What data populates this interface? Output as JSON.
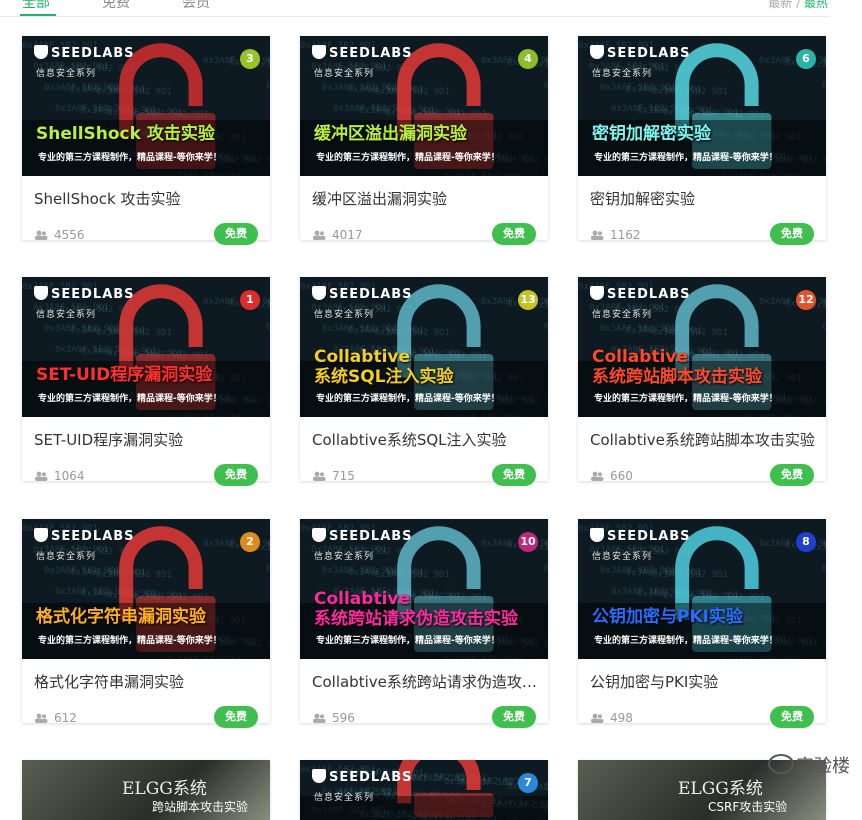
{
  "tabs": [
    {
      "label": "全部",
      "active": true
    },
    {
      "label": "免费",
      "active": false
    },
    {
      "label": "会员",
      "active": false
    }
  ],
  "sort": {
    "newest": "最新",
    "separator": "/",
    "hottest": "最热"
  },
  "logo": {
    "brand": "SEEDLABS",
    "series": "信息安全系列"
  },
  "tagline": "专业的第三方课程制作，精品课程-等你来学！",
  "courses": [
    {
      "banner_line1": "ShellShock 攻击实验",
      "banner_line2": "",
      "banner_color": "#b8f040",
      "number": "3",
      "num_color": "#9ac229",
      "lock_color": "#d32f2f",
      "title": "ShellShock 攻击实验",
      "users": "4556",
      "badge": "免费"
    },
    {
      "banner_line1": "缓冲区溢出漏洞实验",
      "banner_line2": "",
      "banner_color": "#b8f040",
      "number": "4",
      "num_color": "#8bbd2a",
      "lock_color": "#e53935",
      "title": "缓冲区溢出漏洞实验",
      "users": "4017",
      "badge": "免费"
    },
    {
      "banner_line1": "密钥加解密实验",
      "banner_line2": "",
      "banner_color": "#7ef4f0",
      "number": "6",
      "num_color": "#2bb3a8",
      "lock_color": "#56d8e0",
      "title": "密钥加解密实验",
      "users": "1162",
      "badge": "免费"
    },
    {
      "banner_line1": "SET-UID程序漏洞实验",
      "banner_line2": "",
      "banner_color": "#ff3030",
      "number": "1",
      "num_color": "#e02b2b",
      "lock_color": "#e53935",
      "title": "SET-UID程序漏洞实验",
      "users": "1064",
      "badge": "免费"
    },
    {
      "banner_line1": "Collabtive",
      "banner_line2": "系统SQL注入实验",
      "banner_color": "#f5d020",
      "number": "13",
      "num_color": "#c2c229",
      "lock_color": "#5fb9c8",
      "title": "Collabtive系统SQL注入实验",
      "users": "715",
      "badge": "免费"
    },
    {
      "banner_line1": "Collabtive",
      "banner_line2": "系统跨站脚本攻击实验",
      "banner_color": "#ff4a2a",
      "number": "12",
      "num_color": "#e0532b",
      "lock_color": "#5fb9c8",
      "title": "Collabtive系统跨站脚本攻击实验",
      "users": "660",
      "badge": "免费"
    },
    {
      "banner_line1": "格式化字符串漏洞实验",
      "banner_line2": "",
      "banner_color": "#ffb020",
      "number": "2",
      "num_color": "#e08a1b",
      "lock_color": "#e53935",
      "title": "格式化字符串漏洞实验",
      "users": "612",
      "badge": "免费"
    },
    {
      "banner_line1": "Collabtive",
      "banner_line2": "系统跨站请求伪造攻击实验",
      "banner_color": "#ff2aa0",
      "number": "10",
      "num_color": "#c0267a",
      "lock_color": "#5fb9c8",
      "title": "Collabtive系统跨站请求伪造攻击实验",
      "users": "596",
      "badge": "免费"
    },
    {
      "banner_line1": "公钥加密与PKI实验",
      "banner_line2": "",
      "banner_color": "#2a6cff",
      "number": "8",
      "num_color": "#1f3fd0",
      "lock_color": "#4fd0e0",
      "title": "公钥加密与PKI实验",
      "users": "498",
      "badge": "免费"
    }
  ],
  "partial_row": [
    {
      "kind": "elgg",
      "line1": "ELGG系统",
      "line2": "跨站脚本攻击实验"
    },
    {
      "kind": "seed",
      "number": "7",
      "num_color": "#2a88d8"
    },
    {
      "kind": "elgg",
      "line1": "ELGG系统",
      "line2": "CSRF攻击实验"
    }
  ],
  "watermark": "实验楼"
}
